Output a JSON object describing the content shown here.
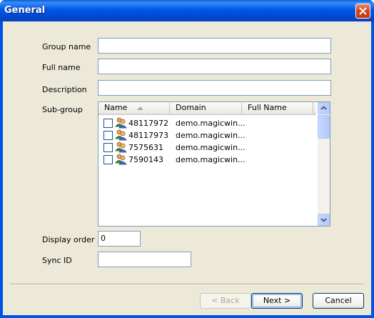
{
  "window": {
    "title": "General"
  },
  "form": {
    "group_name": {
      "label": "Group name",
      "value": ""
    },
    "full_name": {
      "label": "Full name",
      "value": ""
    },
    "description": {
      "label": "Description",
      "value": ""
    },
    "sub_group": {
      "label": "Sub-group",
      "columns": [
        "Name",
        "Domain",
        "Full Name"
      ],
      "rows": [
        {
          "name": "48117972",
          "domain": "demo.magicwin...",
          "full_name": ""
        },
        {
          "name": "48117973",
          "domain": "demo.magicwin...",
          "full_name": ""
        },
        {
          "name": "7575631",
          "domain": "demo.magicwin...",
          "full_name": ""
        },
        {
          "name": "7590143",
          "domain": "demo.magicwin...",
          "full_name": ""
        }
      ]
    },
    "display_order": {
      "label": "Display order",
      "value": "0"
    },
    "sync_id": {
      "label": "Sync ID",
      "value": ""
    }
  },
  "buttons": {
    "back": "< Back",
    "next": "Next >",
    "cancel": "Cancel"
  },
  "icons": {
    "close": "close-icon",
    "group": "group-icon",
    "sort": "sort-ascending-icon",
    "scroll_up": "scroll-up-icon",
    "scroll_down": "scroll-down-icon"
  },
  "colors": {
    "titlebar": "#0054e3",
    "client": "#ece9d8",
    "field_border": "#7f9db9"
  }
}
